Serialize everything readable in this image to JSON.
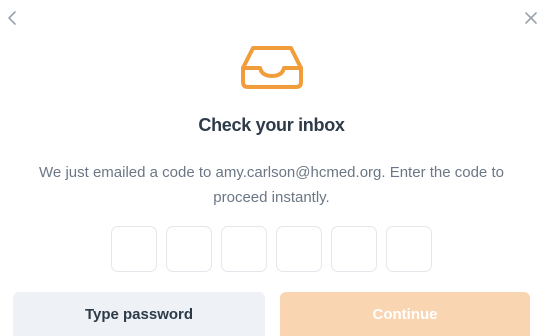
{
  "dialog": {
    "title": "Check your inbox",
    "description": "We just emailed a code to amy.carlson@hcmed.org. Enter the code to proceed instantly.",
    "code_length": 6,
    "code_digits": [
      "",
      "",
      "",
      "",
      "",
      ""
    ]
  },
  "nav": {
    "back_icon": "chevron-left-icon",
    "close_icon": "close-icon"
  },
  "buttons": {
    "type_password_label": "Type password",
    "continue_label": "Continue"
  },
  "colors": {
    "accent": "#f29d3b",
    "continue_disabled_bg": "#fad5b2",
    "secondary_bg": "#eef2f7",
    "title_text": "#2d3a48",
    "body_text": "#6b7785",
    "icon_gray": "#9aa3ad"
  }
}
